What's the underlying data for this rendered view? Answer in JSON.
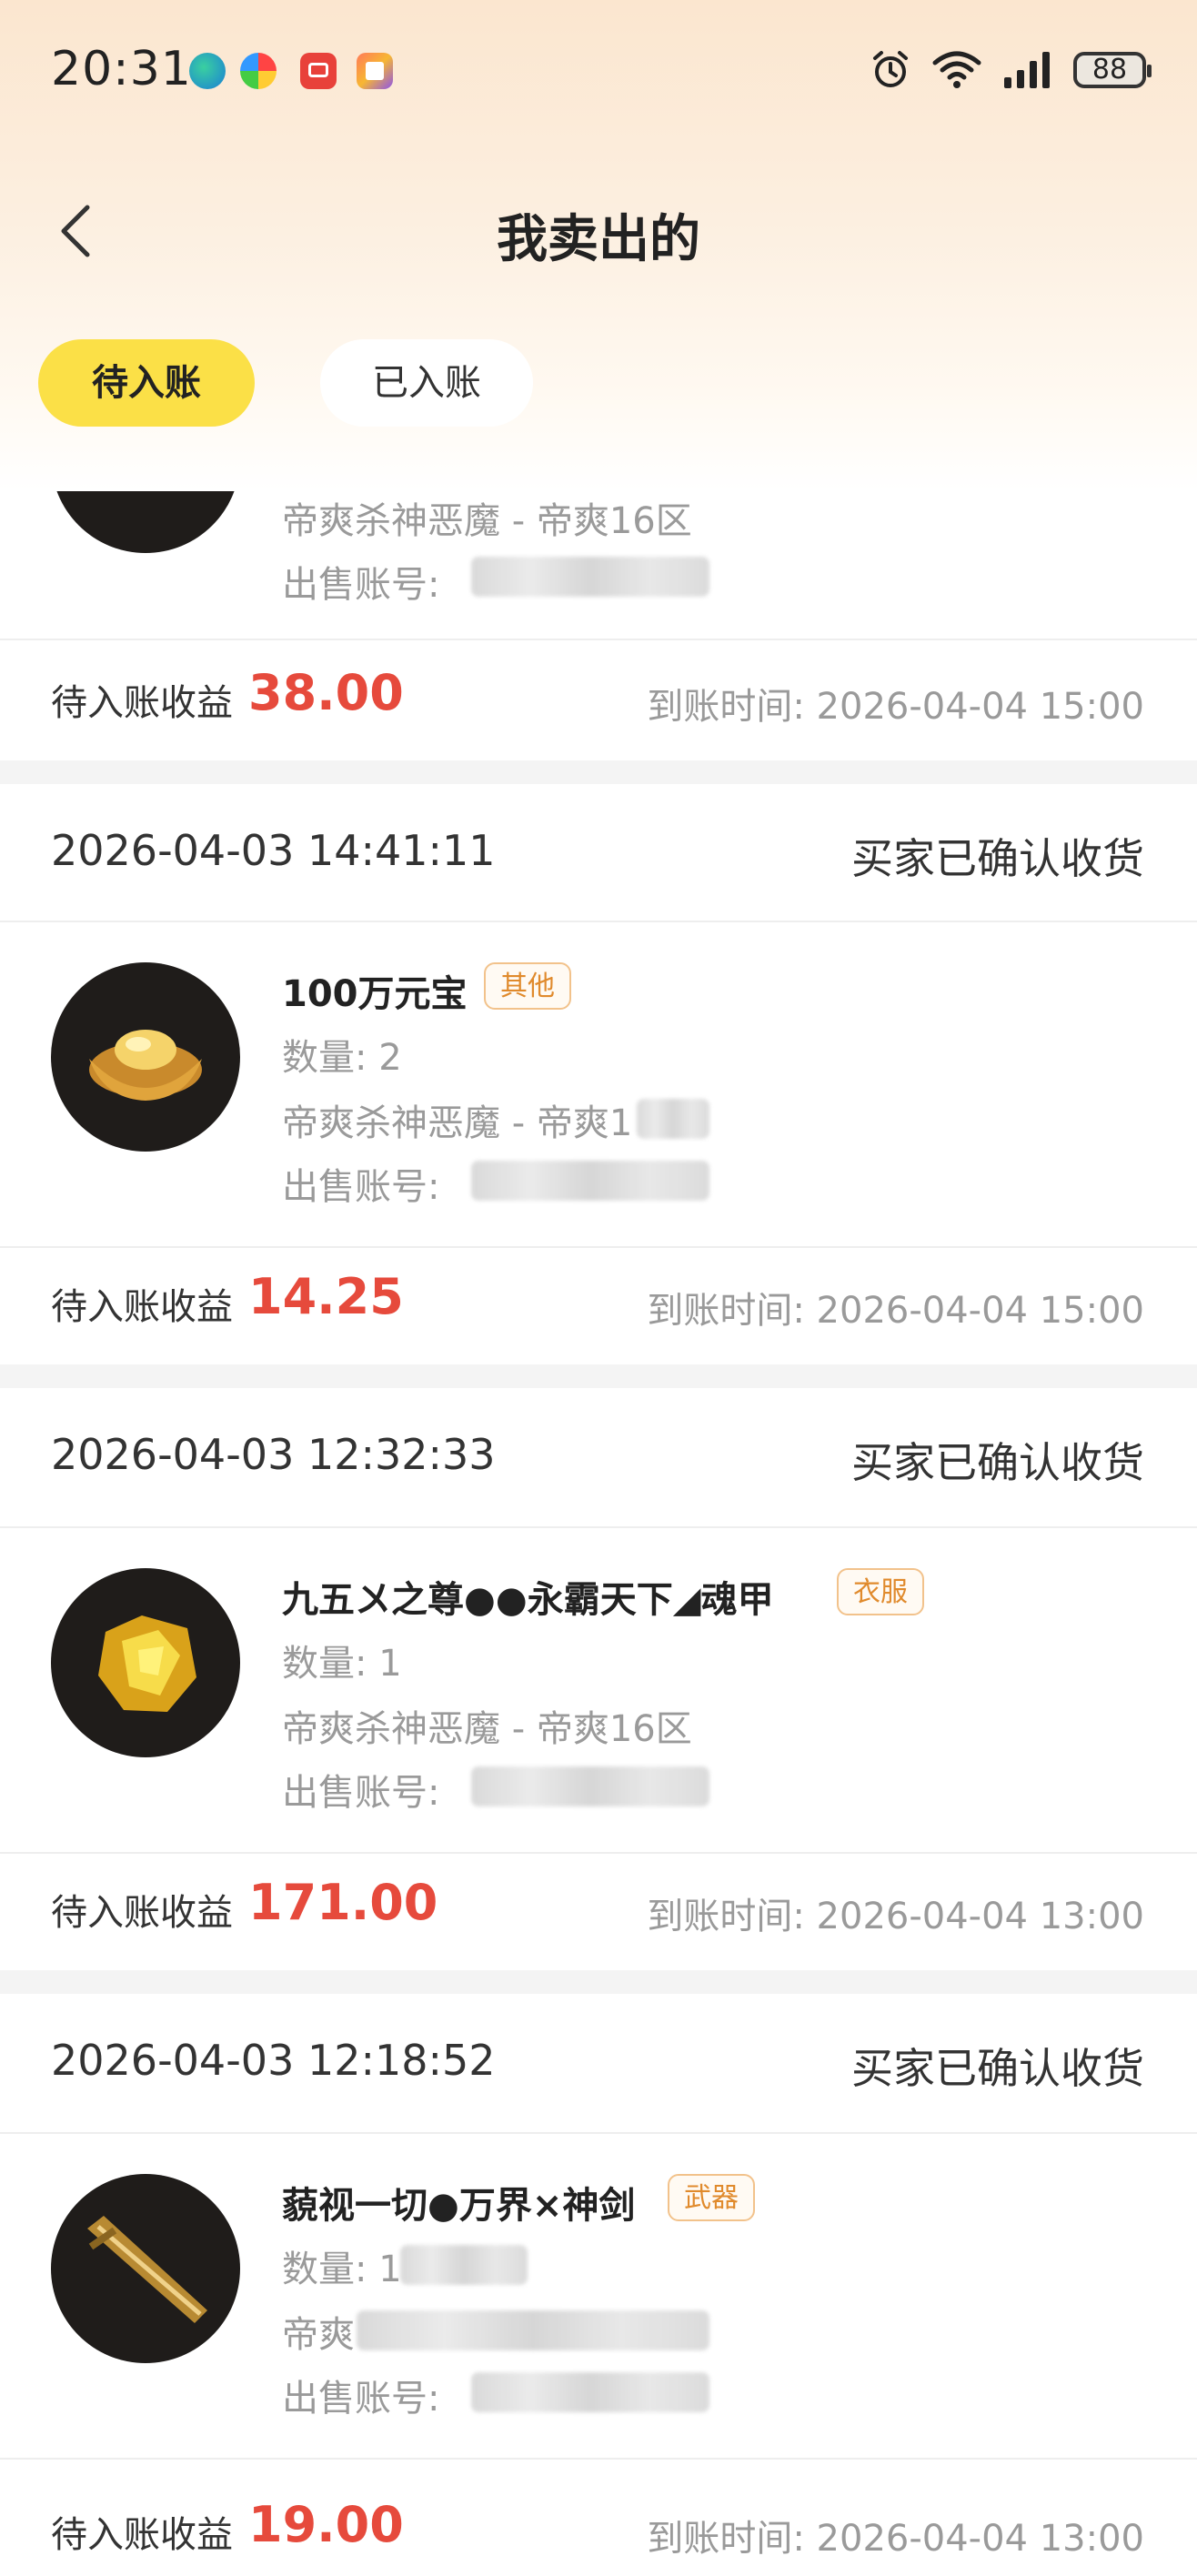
{
  "status_bar": {
    "time": "20:31",
    "battery": "88",
    "icons": [
      "edge-app-icon",
      "photos-app-icon",
      "red-app-icon",
      "tool-app-icon",
      "alarm-icon",
      "wifi-icon",
      "signal-icon"
    ]
  },
  "nav": {
    "title": "我卖出的",
    "back_icon": "back-arrow-icon"
  },
  "tabs": [
    {
      "label": "待入账",
      "active": true
    },
    {
      "label": "已入账",
      "active": false
    }
  ],
  "colors": {
    "accent": "#fbe047",
    "earning": "#e64a3c",
    "tag_text": "#e08a2c",
    "tag_border": "#f2c28b"
  },
  "partial_order": {
    "server": "帝爽杀神恶魔 - 帝爽16区",
    "account_label": "出售账号:",
    "earning_label": "待入账收益",
    "earning": "38.00",
    "arrive": "到账时间:  2026-04-04 15:00"
  },
  "orders": [
    {
      "time": "2026-04-03 14:41:11",
      "status": "买家已确认收货",
      "name": "100万元宝",
      "tag": "其他",
      "quantity": "数量:  2",
      "server": "帝爽杀神恶魔 - 帝爽1",
      "account_label": "出售账号:",
      "earning_label": "待入账收益",
      "earning": "14.25",
      "arrive": "到账时间:  2026-04-04 15:00"
    },
    {
      "time": "2026-04-03 12:32:33",
      "status": "买家已确认收货",
      "name": "九五〤之尊●●永霸天下◢魂甲",
      "tag": "衣服",
      "quantity": "数量:  1",
      "server": "帝爽杀神恶魔 - 帝爽16区",
      "account_label": "出售账号:",
      "earning_label": "待入账收益",
      "earning": "171.00",
      "arrive": "到账时间:  2026-04-04 13:00"
    },
    {
      "time": "2026-04-03 12:18:52",
      "status": "买家已确认收货",
      "name": "藐视一切●万界×神剑",
      "tag": "武器",
      "quantity": "数量:  1",
      "server": "帝爽",
      "account_label": "出售账号:",
      "earning_label": "待入账收益",
      "earning": "19.00",
      "arrive": "到账时间:  2026-04-04 13:00"
    }
  ]
}
